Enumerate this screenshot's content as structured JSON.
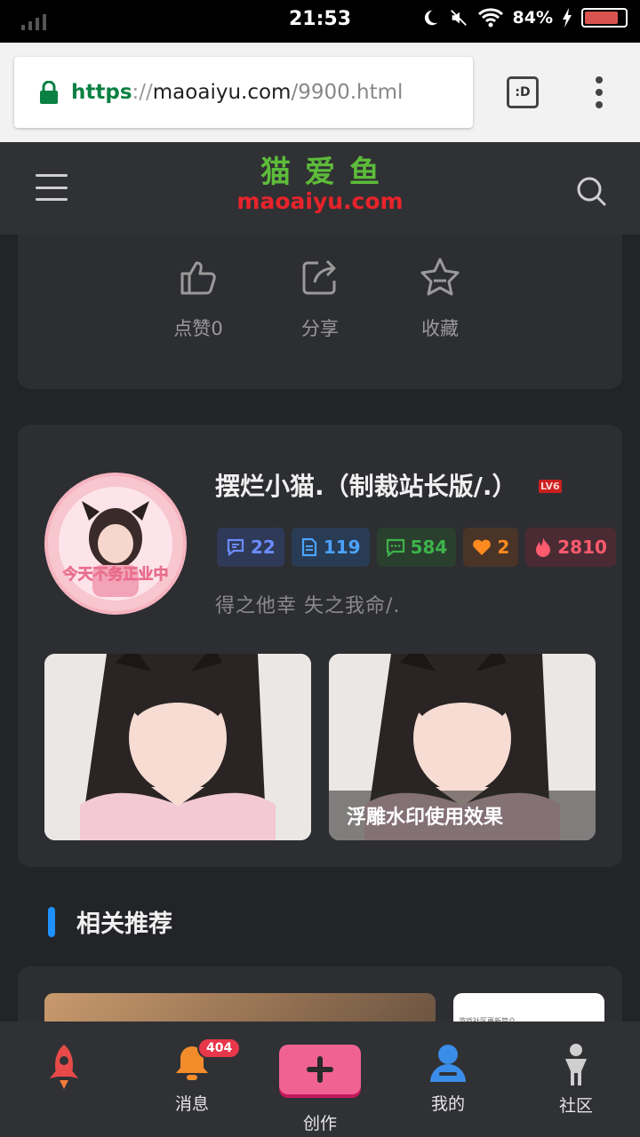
{
  "status_bar": {
    "time": "21:53",
    "battery": "84%"
  },
  "browser": {
    "url_scheme": "https",
    "url_sep": "://",
    "url_host": "maoaiyu.com",
    "url_path": "/9900.html",
    "tab_label": ":D"
  },
  "site": {
    "logo_cn": "猫爱鱼",
    "logo_en": "maoaiyu.com"
  },
  "actions": [
    {
      "label": "点赞",
      "count": "0"
    },
    {
      "label": "分享"
    },
    {
      "label": "收藏"
    }
  ],
  "author": {
    "name": "摆烂小猫.（制裁站长版/.）",
    "level": "LV6",
    "motto": "得之他幸 失之我命/.",
    "avatar_text": "今天不务正业中",
    "stats": [
      {
        "value": "22",
        "color": "#6c8cff"
      },
      {
        "value": "119",
        "color": "#4da3ff"
      },
      {
        "value": "584",
        "color": "#3db34a"
      },
      {
        "value": "2",
        "color": "#ff8a1f"
      },
      {
        "value": "2810",
        "color": "#ff5a6e"
      }
    ],
    "photo_caption": "浮雕水印使用效果"
  },
  "related": {
    "heading": "相关推荐",
    "snippet": "游戏社区更新简介"
  },
  "bottom_nav": {
    "badge": "404",
    "messages": "消息",
    "create": "创作",
    "me": "我的",
    "community": "社区"
  },
  "colors": {
    "accent_pink": "#f06292",
    "logo_green": "#5dbb3a",
    "logo_red": "#e8232a",
    "rel_bar": "#1e90ff"
  }
}
